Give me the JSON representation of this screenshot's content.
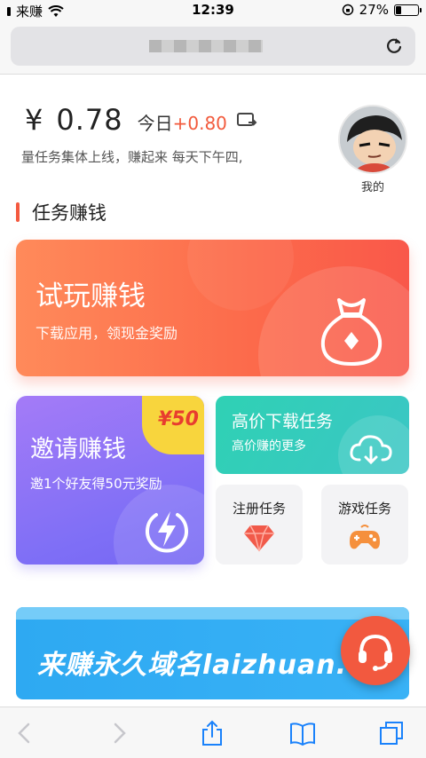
{
  "status_bar": {
    "carrier": "来赚",
    "time": "12:39",
    "battery_percent": "27%",
    "battery_level": 0.27
  },
  "browser": {
    "url_redacted": true,
    "reload_icon": "reload-icon"
  },
  "header": {
    "currency": "¥",
    "balance": "0.78",
    "today_label": "今日",
    "today_value": "+0.80",
    "subtitle": "量任务集体上线，赚起来     每天下午四,",
    "profile_label": "我的"
  },
  "section": {
    "title": "任务赚钱"
  },
  "cards": {
    "trial": {
      "title": "试玩赚钱",
      "subtitle": "下载应用，领现金奖励",
      "icon": "money-bag-icon"
    },
    "invite": {
      "title": "邀请赚钱",
      "subtitle": "邀1个好友得50元奖励",
      "badge": "¥50",
      "icon": "lightning-icon"
    },
    "download": {
      "title": "高价下载任务",
      "subtitle": "高价赚的更多",
      "icon": "cloud-download-icon"
    },
    "register": {
      "title": "注册任务",
      "icon": "diamond-icon"
    },
    "game": {
      "title": "游戏任务",
      "icon": "gamepad-icon"
    }
  },
  "banner": {
    "text": "来赚永久域名laizhuan.co"
  },
  "toolbar": {
    "icons": [
      "back-icon",
      "forward-icon",
      "share-icon",
      "bookmarks-icon",
      "tabs-icon"
    ]
  },
  "colors": {
    "accent_red": "#f4593f",
    "trial_gradient": [
      "#ff8a5a",
      "#f9584a"
    ],
    "invite_gradient": [
      "#a47bf7",
      "#7566f3"
    ],
    "download_gradient": [
      "#2fd1b4",
      "#3bc6c5"
    ],
    "banner_blue": "#2ea9f2",
    "badge_yellow": "#f8d53d"
  }
}
